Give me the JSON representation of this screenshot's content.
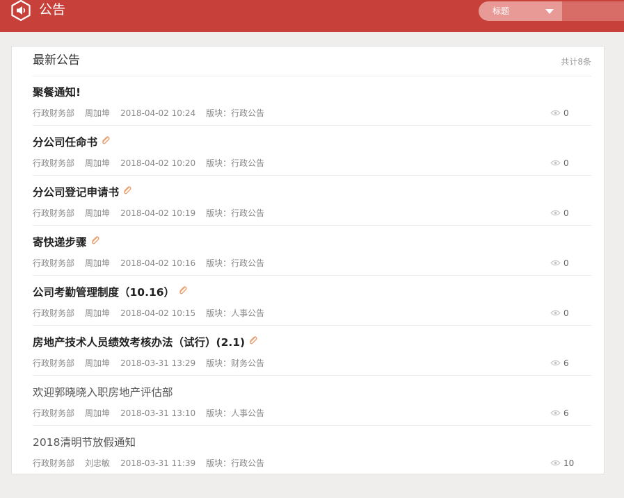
{
  "header": {
    "title": "公告",
    "search": {
      "selected_field": "标题",
      "input_value": "",
      "placeholder": ""
    }
  },
  "panel": {
    "title": "最新公告",
    "count_text": "共计8条",
    "items": [
      {
        "title": "聚餐通知!",
        "bold": true,
        "attachment": false,
        "department": "行政财务部",
        "author": "周加坤",
        "date": "2018-04-02 10:24",
        "board": "版块：行政公告",
        "views": "0"
      },
      {
        "title": "分公司任命书",
        "bold": true,
        "attachment": true,
        "department": "行政财务部",
        "author": "周加坤",
        "date": "2018-04-02 10:20",
        "board": "版块：行政公告",
        "views": "0"
      },
      {
        "title": "分公司登记申请书",
        "bold": true,
        "attachment": true,
        "department": "行政财务部",
        "author": "周加坤",
        "date": "2018-04-02 10:19",
        "board": "版块：行政公告",
        "views": "0"
      },
      {
        "title": "寄快递步骤",
        "bold": true,
        "attachment": true,
        "department": "行政财务部",
        "author": "周加坤",
        "date": "2018-04-02 10:16",
        "board": "版块：行政公告",
        "views": "0"
      },
      {
        "title": "公司考勤管理制度（10.16）",
        "bold": true,
        "attachment": true,
        "department": "行政财务部",
        "author": "周加坤",
        "date": "2018-04-02 10:15",
        "board": "版块：人事公告",
        "views": "0"
      },
      {
        "title": "房地产技术人员绩效考核办法（试行）(2.1)",
        "bold": true,
        "attachment": true,
        "department": "行政财务部",
        "author": "周加坤",
        "date": "2018-03-31 13:29",
        "board": "版块：财务公告",
        "views": "6"
      },
      {
        "title": "欢迎郭晓晓入职房地产评估部",
        "bold": false,
        "attachment": false,
        "department": "行政财务部",
        "author": "周加坤",
        "date": "2018-03-31 13:10",
        "board": "版块：人事公告",
        "views": "6"
      },
      {
        "title": "2018清明节放假通知",
        "bold": false,
        "attachment": false,
        "department": "行政财务部",
        "author": "刘忠敏",
        "date": "2018-03-31 11:39",
        "board": "版块：行政公告",
        "views": "10"
      }
    ]
  },
  "colors": {
    "header_bg": "#c8403a",
    "attachment_icon": "#e8a070",
    "eye_icon": "#c8c8c8"
  },
  "icons": {
    "app": "megaphone-hexagon-icon",
    "attachment": "paperclip-icon",
    "views": "eye-icon",
    "dropdown": "caret-down-icon"
  }
}
